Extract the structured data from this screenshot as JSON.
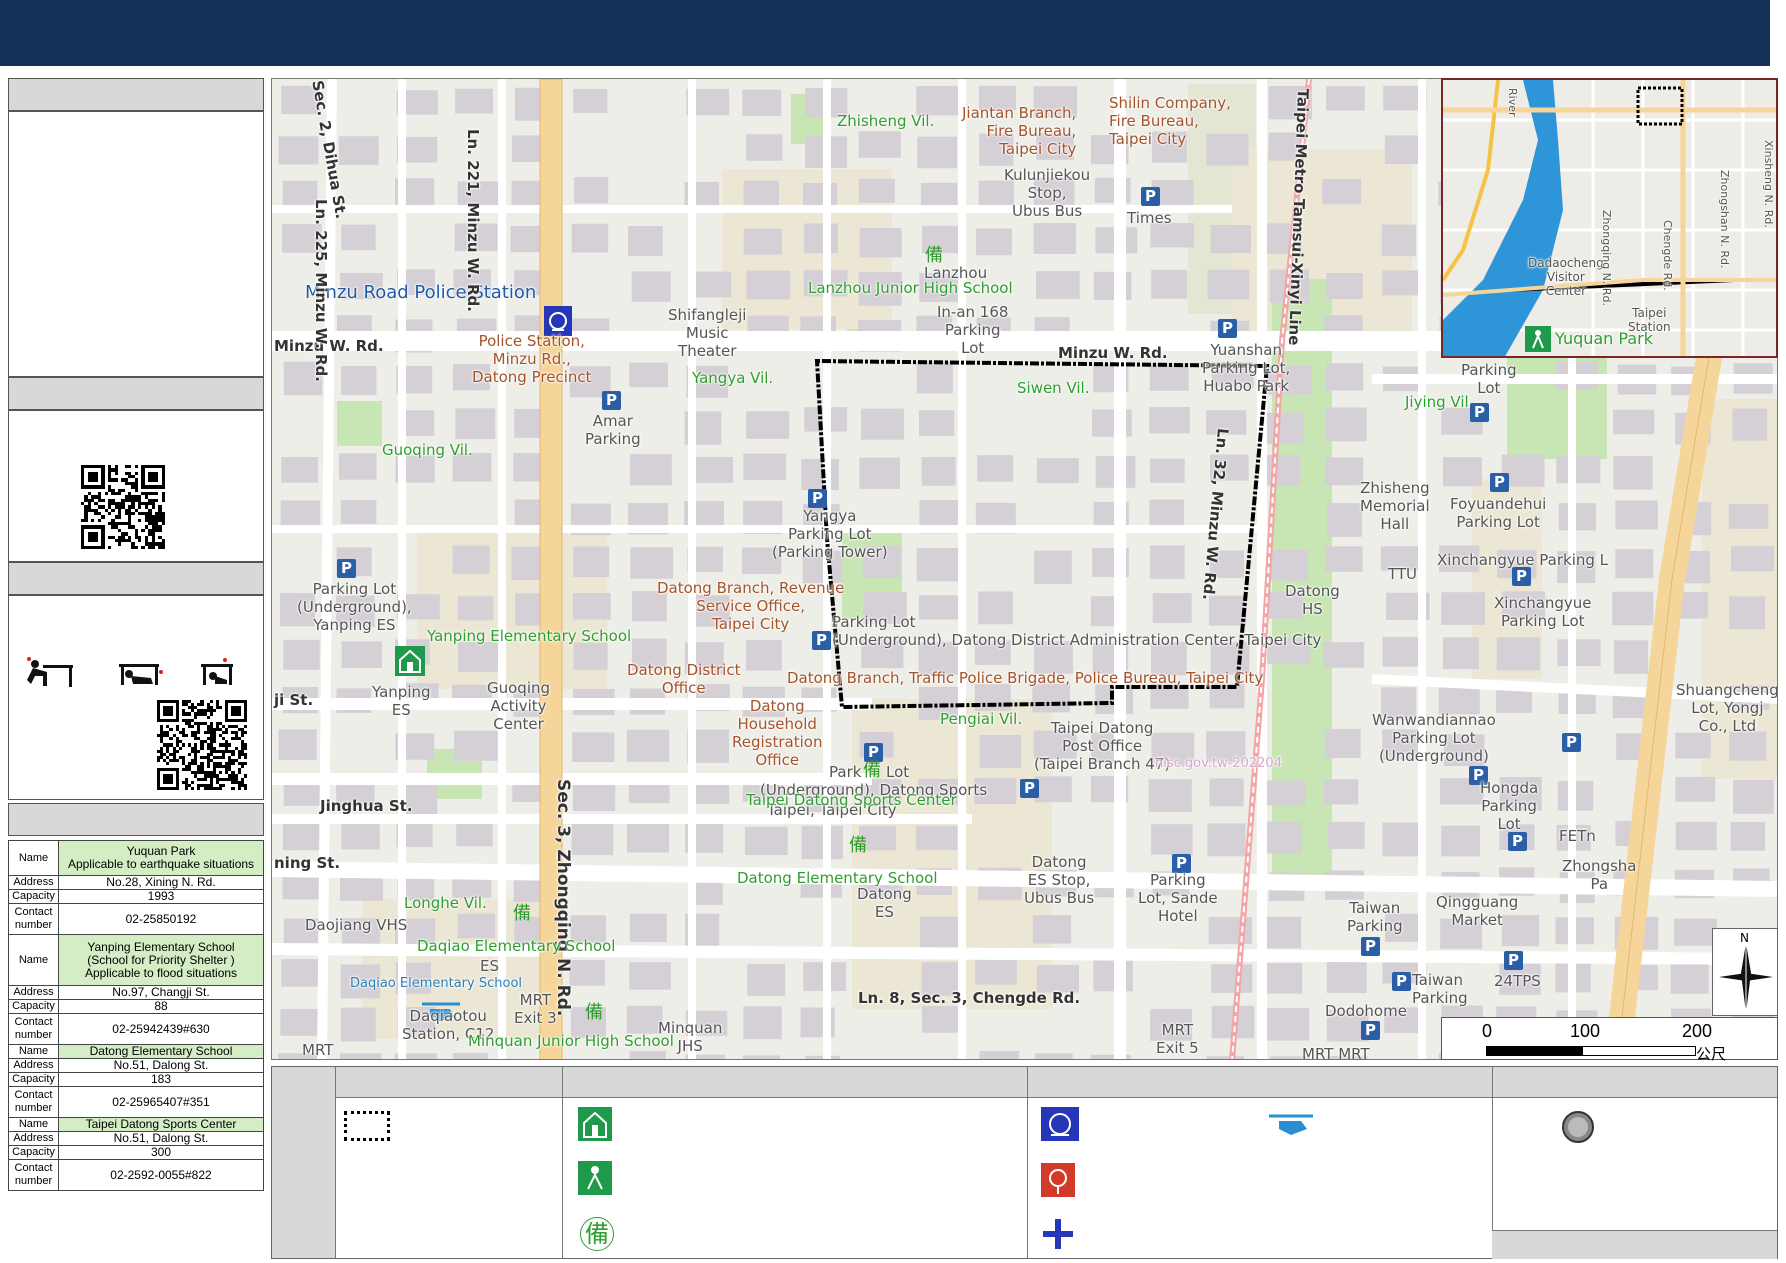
{
  "map": {
    "villages": [
      "Zhisheng Vil.",
      "Yangya Vil.",
      "Siwen Vil.",
      "Guoqing Vil.",
      "Jiying Vil.",
      "Pengiai Vil.",
      "Longhe Vil."
    ],
    "police_station_label": "Minzu Road Police Station",
    "police_station_detail": [
      "Police Station,",
      "Minzu Rd.,",
      "Datong Precinct"
    ],
    "fire_label": [
      "Jiantan Branch,",
      "Fire Bureau,",
      "Taipei City"
    ],
    "fire_label2": [
      "Shilin Company,",
      "Fire Bureau,",
      "Taipei City"
    ],
    "kulunjiekou": [
      "Kulunjiekou",
      "Stop,",
      "Ubus Bus"
    ],
    "times": "Times",
    "lanzhou_short": "Lanzhou",
    "lanzhou_school": "Lanzhou Junior High School",
    "inan": [
      "In-an 168",
      "Parking",
      "Lot"
    ],
    "shifangleji": [
      "Shifangleji",
      "Music",
      "Theater"
    ],
    "amar": [
      "Amar",
      "Parking"
    ],
    "roads": {
      "minzu_w_left": "Minzu W. Rd.",
      "minzu_w_right": "Minzu W. Rd.",
      "ln225": "Ln. 225, Minzu W. Rd.",
      "ln221": "Ln. 221, Minzu W. Rd.",
      "dihua": "Sec. 2, Dihua St.",
      "metro": "Taipei Metro Tamsui-Xinyi Line",
      "ln32": "Ln. 32, Minzu W. Rd.",
      "zhongqing": "Sec. 3, Zhongqing N. Rd.",
      "jinghua": "Jinghua St.",
      "ji_st": "ji St.",
      "ning_st": "ning St.",
      "ln8": "Ln. 8, Sec. 3, Chengde Rd."
    },
    "yuanshan": [
      "Yuanshan",
      "Parking Lot,",
      "Huabo Park"
    ],
    "parking_lot_right": [
      "Parking",
      "Lot"
    ],
    "yangya_parking": [
      "Yangya",
      "Parking Lot",
      "(Parking Tower)"
    ],
    "pl_underground_yanping": [
      "Parking Lot",
      "(Underground),",
      "Yanping ES"
    ],
    "revenue": [
      "Datong Branch, Revenue",
      "Service Office,",
      "Taipei City"
    ],
    "admin_center": [
      "Parking Lot",
      "(Underground), Datong District Administration Center, Taipei City"
    ],
    "district_office": [
      "Datong District",
      "Office"
    ],
    "traffic_police": "Datong Branch, Traffic Police Brigade, Police Bureau, Taipei City",
    "household": [
      "Datong",
      "Household",
      "Registration",
      "Office"
    ],
    "yanping_school": "Yanping Elementary School",
    "yanping_es": [
      "Yanping",
      "ES"
    ],
    "guoqing_center": [
      "Guoqing",
      "Activity",
      "Center"
    ],
    "zhisheng_hall": [
      "Zhisheng",
      "Memorial",
      "Hall"
    ],
    "ttu": "TTU",
    "datong_hs": [
      "Datong",
      "HS"
    ],
    "foyuandehui": [
      "Foyuandehui",
      "Parking Lot"
    ],
    "xinchangyue1": "Xinchangyue Parking L",
    "xinchangyue2": [
      "Xinchangyue",
      "Parking Lot"
    ],
    "shuangcheng": [
      "Shuangcheng",
      "Lot, Yongj",
      "Co., Ltd"
    ],
    "wanwan": [
      "Wanwandiannao",
      "Parking Lot",
      "(Underground)"
    ],
    "hongda": [
      "Hongda",
      "Parking",
      "Lot"
    ],
    "fetn": "FETn",
    "zhongsha": [
      "Zhongsha",
      "Pa"
    ],
    "qingguang": [
      "Qingguang",
      "Market"
    ],
    "post_office": [
      "Taipei Datong",
      "Post Office",
      "(Taipei Branch 47)"
    ],
    "watermark": "nlsc.gov.tw-202204",
    "sports_parking": [
      "Park",
      "Lot",
      "(Underground), Datong Sports",
      "Taipei, Taipei City"
    ],
    "sports_center": "Taipei Datong Sports Center",
    "datong_school": "Datong Elementary School",
    "datong_es": [
      "Datong",
      "ES"
    ],
    "datong_es_stop": [
      "Datong",
      "ES Stop,",
      "Ubus Bus"
    ],
    "sande": [
      "Parking",
      "Lot, Sande",
      "Hotel"
    ],
    "taiwan_parking": [
      "Taiwan",
      "Parking"
    ],
    "taiwan_parking2": [
      "Taiwan",
      "Parking"
    ],
    "tps24": "24TPS",
    "dodohome": "Dodohome",
    "daojiang": "Daojiang VHS",
    "daqiao_school": "Daqiao Elementary School",
    "daqiao_es": "ES",
    "daqiao_small": "Daqiao Elementary School",
    "daqiaotou": [
      "Daqiaotou",
      "Station, C12"
    ],
    "mrt_exit3": [
      "MRT",
      "Exit 3"
    ],
    "minquan_school": "Minquan Junior High School",
    "minquan_jhs": [
      "Minquan",
      "JHS"
    ],
    "mrt_exit5": [
      "MRT",
      "Exit 5"
    ],
    "mrt_left": "MRT",
    "mrt_bottom": "MRT  MRT",
    "inset": {
      "dadaocheng": [
        "Dadaocheng",
        "Visitor",
        "Center"
      ],
      "taipei_station": [
        "Taipei",
        "Station"
      ],
      "yuquan": "Yuquan Park",
      "river": "River",
      "roads": [
        "Zhongqing N. Rd.",
        "Chengde Rd.",
        "Zhongshan N. Rd.",
        "Xinsheng N. Rd."
      ]
    },
    "scale": {
      "ticks": [
        "0",
        "100",
        "200"
      ],
      "unit": "公尺"
    },
    "compass_n": "N"
  },
  "shelters": [
    {
      "name": "Yuquan Park",
      "note": "Applicable to earthquake situations",
      "address": "No.28, Xining N. Rd.",
      "capacity": "1993",
      "contact": "02-25850192"
    },
    {
      "name": "Yanping Elementary School",
      "note": "(School for Priority Shelter )",
      "note2": "Applicable to flood situations",
      "address": "No.97, Changji St.",
      "capacity": "88",
      "contact": "02-25942439#630"
    },
    {
      "name": "Datong Elementary School",
      "address": "No.51, Dalong St.",
      "capacity": "183",
      "contact": "02-25965407#351"
    },
    {
      "name": "Taipei Datong Sports Center",
      "address": "No.51, Dalong St.",
      "capacity": "300",
      "contact": "02-2592-0055#822"
    }
  ],
  "table_keys": {
    "name": "Name",
    "address": "Address",
    "capacity": "Capacity",
    "contact1": "Contact",
    "contact2": "number"
  },
  "colors": {
    "banner": "#143258",
    "police_blue": "#2636b8",
    "fire_red": "#d23a2a",
    "shelter_green": "#1f9a4a",
    "boundary": "#000000"
  },
  "icons": [
    "police-icon",
    "fire-icon",
    "ambulance-icon",
    "helicopter-icon",
    "shelter-icon",
    "park-evacuation-icon",
    "reserve-icon",
    "parking-icon",
    "drop-cover-hold-icon"
  ]
}
